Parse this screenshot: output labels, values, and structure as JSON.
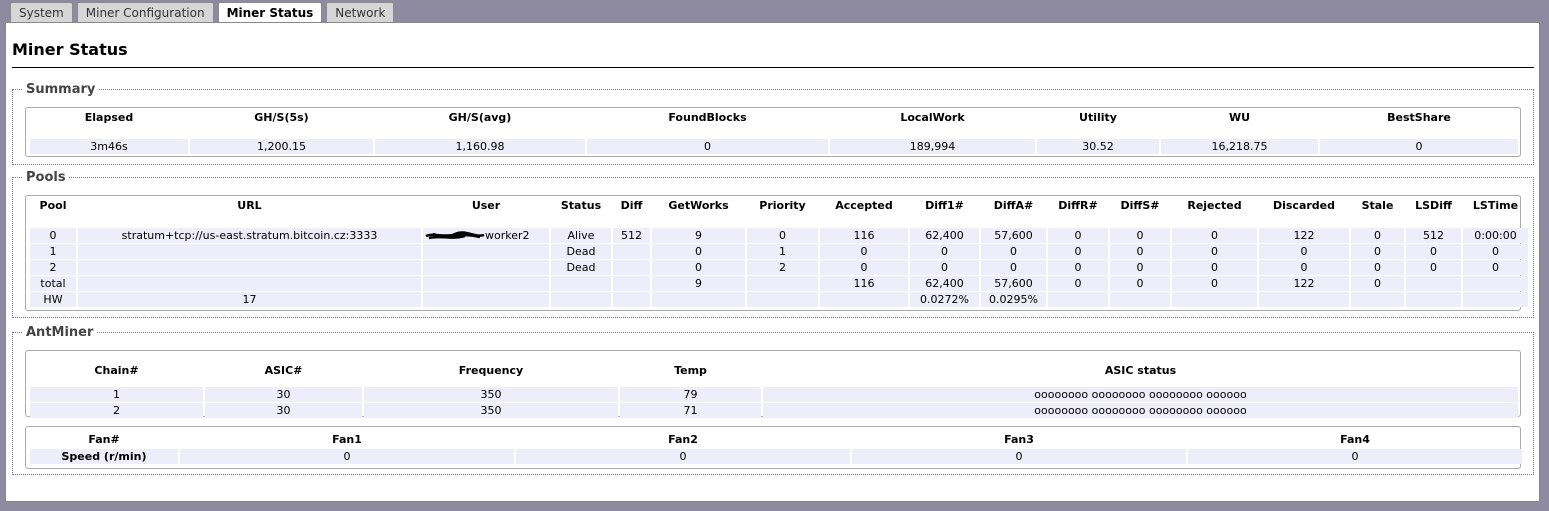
{
  "tabs": [
    {
      "label": "System",
      "active": false
    },
    {
      "label": "Miner Configuration",
      "active": false
    },
    {
      "label": "Miner Status",
      "active": true
    },
    {
      "label": "Network",
      "active": false
    }
  ],
  "page_title": "Miner Status",
  "summary": {
    "legend": "Summary",
    "headers": [
      "Elapsed",
      "GH/S(5s)",
      "GH/S(avg)",
      "FoundBlocks",
      "LocalWork",
      "Utility",
      "WU",
      "BestShare"
    ],
    "row": [
      "3m46s",
      "1,200.15",
      "1,160.98",
      "0",
      "189,994",
      "30.52",
      "16,218.75",
      "0"
    ]
  },
  "pools": {
    "legend": "Pools",
    "headers": [
      "Pool",
      "URL",
      "User",
      "Status",
      "Diff",
      "GetWorks",
      "Priority",
      "Accepted",
      "Diff1#",
      "DiffA#",
      "DiffR#",
      "DiffS#",
      "Rejected",
      "Discarded",
      "Stale",
      "LSDiff",
      "LSTime"
    ],
    "rows": [
      [
        "0",
        "stratum+tcp://us-east.stratum.bitcoin.cz:3333",
        "worker2",
        "Alive",
        "512",
        "9",
        "0",
        "116",
        "62,400",
        "57,600",
        "0",
        "0",
        "0",
        "122",
        "0",
        "512",
        "0:00:00"
      ],
      [
        "1",
        "",
        "",
        "Dead",
        "",
        "0",
        "1",
        "0",
        "0",
        "0",
        "0",
        "0",
        "0",
        "0",
        "0",
        "0",
        "0"
      ],
      [
        "2",
        "",
        "",
        "Dead",
        "",
        "0",
        "2",
        "0",
        "0",
        "0",
        "0",
        "0",
        "0",
        "0",
        "0",
        "0",
        "0"
      ],
      [
        "total",
        "",
        "",
        "",
        "",
        "9",
        "",
        "116",
        "62,400",
        "57,600",
        "0",
        "0",
        "0",
        "122",
        "0",
        "",
        ""
      ],
      [
        "HW",
        "17",
        "",
        "",
        "",
        "",
        "",
        "",
        "0.0272%",
        "0.0295%",
        "",
        "",
        "",
        "",
        "",
        "",
        ""
      ]
    ]
  },
  "antminer": {
    "legend": "AntMiner",
    "chain_headers": [
      "Chain#",
      "ASIC#",
      "Frequency",
      "Temp",
      "ASIC status"
    ],
    "chain_rows": [
      [
        "1",
        "30",
        "350",
        "79",
        "oooooooo oooooooo oooooooo oooooo"
      ],
      [
        "2",
        "30",
        "350",
        "71",
        "oooooooo oooooooo oooooooo oooooo"
      ]
    ],
    "fan_headers": [
      "Fan#",
      "Fan1",
      "Fan2",
      "Fan3",
      "Fan4"
    ],
    "fan_row": [
      "Speed (r/min)",
      "0",
      "0",
      "0",
      "0"
    ]
  },
  "colors": {
    "background": "#8e8aa0",
    "cell": "#eeeefa"
  }
}
